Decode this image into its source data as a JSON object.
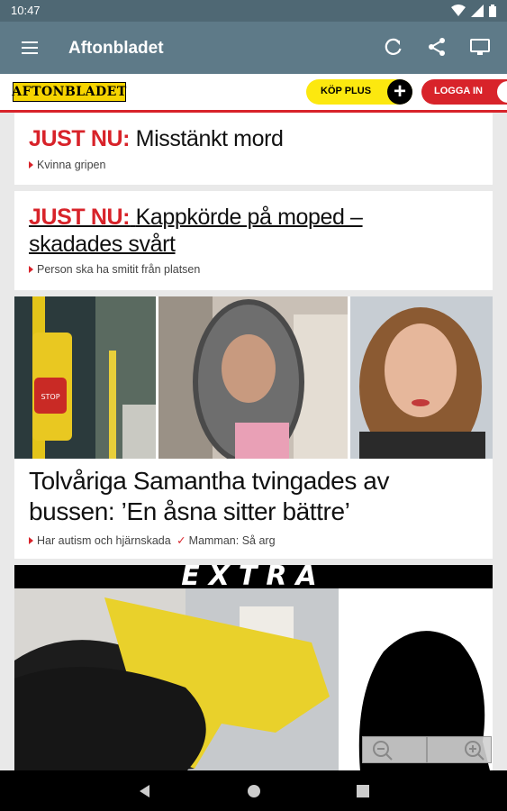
{
  "status_bar": {
    "time": "10:47"
  },
  "app_bar": {
    "title": "Aftonbladet"
  },
  "brand": {
    "logo_text": "AFTONBLADET",
    "kop_plus_label": "KÖP PLUS",
    "logga_in_label": "LOGGA IN",
    "accent_red": "#d8232a",
    "accent_yellow": "#fce80f",
    "app_bar_color": "#5e7a88"
  },
  "articles": [
    {
      "tag": "JUST NU:",
      "title": "Misstänkt mord",
      "sub": [
        "Kvinna gripen"
      ]
    },
    {
      "tag": "JUST NU:",
      "title": "Kappkörde på moped – skadades svårt",
      "sub": [
        "Person ska ha smitit från platsen"
      ]
    },
    {
      "title": "Tolvåriga Samantha tvingades av bussen: ’En åsna sitter bättre’",
      "sub": [
        "Har autism och hjärnskada",
        "Mamman: Så arg"
      ]
    },
    {
      "banner": "EXTRA"
    }
  ],
  "icons": {
    "menu": "menu-icon",
    "refresh": "refresh-icon",
    "share": "share-icon",
    "cast": "cast-icon",
    "zoom_out": "zoom-out-icon",
    "zoom_in": "zoom-in-icon",
    "back": "back-icon",
    "home": "home-icon",
    "recents": "recents-icon"
  }
}
